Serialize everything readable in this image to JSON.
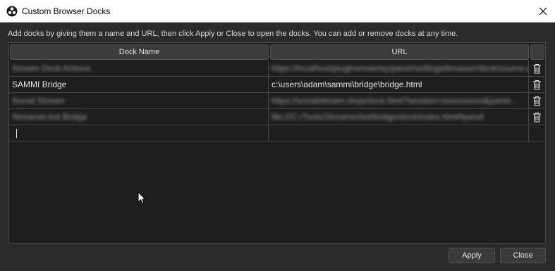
{
  "window": {
    "title": "Custom Browser Docks",
    "close_symbol": "✕"
  },
  "hint": "Add docks by giving them a name and URL, then click Apply or Close to open the docks. You can add or remove docks at any time.",
  "table": {
    "headers": {
      "name": "Dock Name",
      "url": "URL"
    },
    "rows": [
      {
        "name": "Stream Deck Actions",
        "url": "https://localhost/plugins/overlay/panel/settings/browser/dock/source-page"
      },
      {
        "name": "SAMMI Bridge",
        "url": "c:\\users\\adam\\sammi\\bridge\\bridge.html"
      },
      {
        "name": "Social Stream",
        "url": "https://socialstream.ninja/dock.html?session=xxxxxxxxxx&panel..."
      },
      {
        "name": "Streamer.bot Bridge",
        "url": "file:///C:/Tools/Streamerbot/bridge/dock/index.html#panel"
      }
    ]
  },
  "buttons": {
    "apply": "Apply",
    "close": "Close"
  }
}
